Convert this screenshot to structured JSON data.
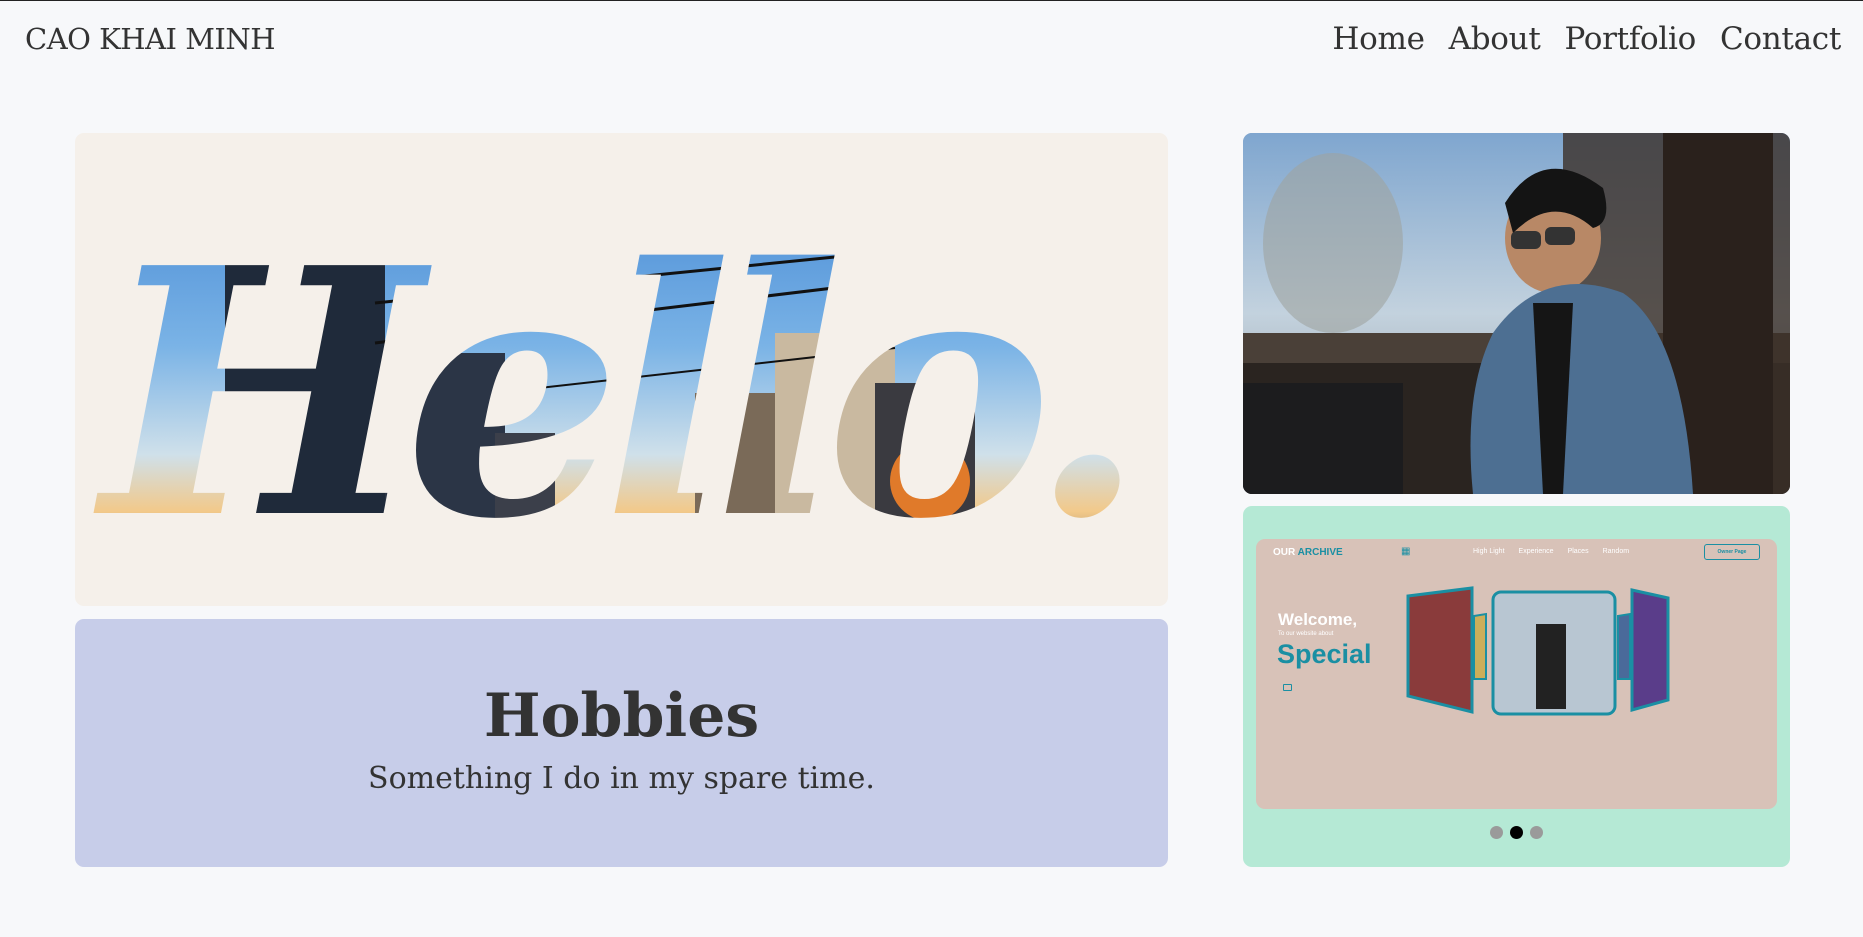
{
  "nav": {
    "brand": "CAO KHAI MINH",
    "links": [
      "Home",
      "About",
      "Portfolio",
      "Contact"
    ]
  },
  "hero": {
    "hello_text": "Hello."
  },
  "hobbies": {
    "title": "Hobbies",
    "subtitle": "Something I do in my spare time."
  },
  "showcase": {
    "logo_prefix": "OUR",
    "logo_suffix": "ARCHIVE",
    "links": [
      "High Light",
      "Experience",
      "Places",
      "Random"
    ],
    "button": "Owner Page",
    "welcome": "Welcome,",
    "sub": "To our website about",
    "special": "Special",
    "carousel_active_index": 1,
    "carousel_count": 3
  },
  "colors": {
    "hello_bg": "#f5f0ea",
    "hobbies_bg": "#c7cde9",
    "showcase_bg": "#b5e9d5",
    "accent": "#1a8fa3"
  }
}
